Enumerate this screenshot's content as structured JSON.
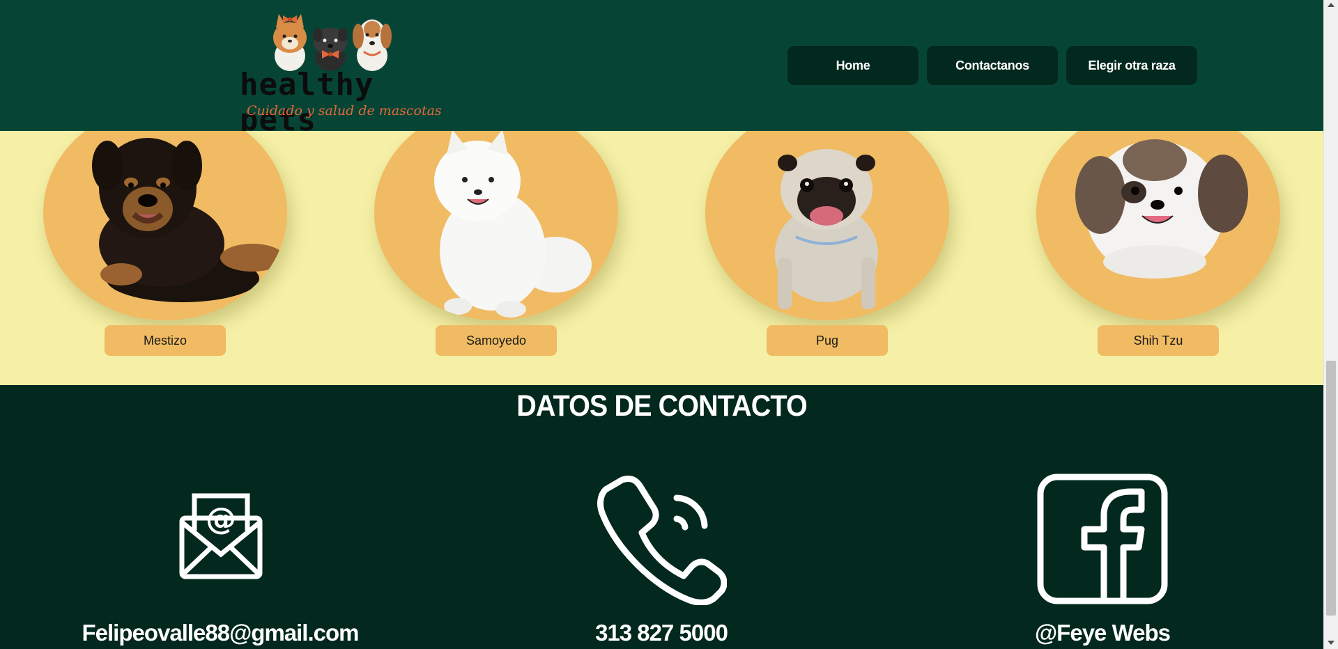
{
  "header": {
    "logo": {
      "name": "healthy pets",
      "tagline": "Cuidado y salud de mascotas"
    },
    "nav": [
      {
        "label": "Home"
      },
      {
        "label": "Contactanos"
      },
      {
        "label": "Elegir otra raza"
      }
    ]
  },
  "breeds": [
    {
      "label": "Mestizo",
      "icon": "mestizo-dog-image"
    },
    {
      "label": "Samoyedo",
      "icon": "samoyed-dog-image"
    },
    {
      "label": "Pug",
      "icon": "pug-dog-image"
    },
    {
      "label": "Shih Tzu",
      "icon": "shih-tzu-dog-image"
    }
  ],
  "contact": {
    "title": "DATOS DE CONTACTO",
    "items": [
      {
        "icon": "email-icon",
        "text": "Felipeovalle88@gmail.com"
      },
      {
        "icon": "phone-icon",
        "text": "313 827 5000"
      },
      {
        "icon": "facebook-icon",
        "text": "@Feye Webs"
      }
    ]
  },
  "colors": {
    "header_bg": "#064535",
    "nav_button_bg": "#03281e",
    "breeds_bg": "#f5f0a6",
    "breed_circle": "#f0bb62",
    "contact_bg": "#03281e",
    "tagline": "#e0683a"
  }
}
